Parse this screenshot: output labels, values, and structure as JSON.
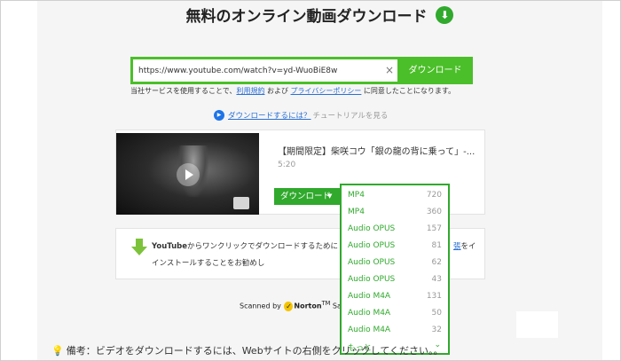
{
  "header": {
    "title": "無料のオンライン動画ダウンロード",
    "download_icon": "download-arrow-icon"
  },
  "search": {
    "url_value": "https://www.youtube.com/watch?v=yd-WuoBiE8w",
    "clear_icon": "×",
    "download_label": "ダウンロード"
  },
  "terms": {
    "prefix": "当社サービスを使用することで、",
    "terms_link": "利用規約",
    "and": " および ",
    "privacy_link": "プライバシーポリシー",
    "suffix": " に同意したことになります。"
  },
  "howto": {
    "link": "ダウンロードするには？",
    "tutorial": "チュートリアルを見る"
  },
  "result": {
    "title": "【期間限定】柴咲コウ「銀の龍の背に乗って」-...",
    "duration": "5:20",
    "download_label": "ダウンロード",
    "caret": "▼"
  },
  "dropdown": {
    "items": [
      {
        "format": "MP4",
        "quality": "720"
      },
      {
        "format": "MP4",
        "quality": "360"
      },
      {
        "format": "Audio OPUS",
        "quality": "157"
      },
      {
        "format": "Audio OPUS",
        "quality": "81"
      },
      {
        "format": "Audio OPUS",
        "quality": "62"
      },
      {
        "format": "Audio OPUS",
        "quality": "43"
      },
      {
        "format": "Audio M4A",
        "quality": "131"
      },
      {
        "format": "Audio M4A",
        "quality": "50"
      },
      {
        "format": "Audio M4A",
        "quality": "32"
      }
    ],
    "more_label": "もっと",
    "chevron": "⌄"
  },
  "promo": {
    "brand": "YouTube",
    "line1": "からワンクリックでダウンロードするために",
    "line2": "インストールすることをお勧めし",
    "tail_link": "張",
    "tail_text": "をイ"
  },
  "scanned": {
    "prefix": "Scanned by",
    "brand": "Norton",
    "tm": "TM",
    "suffix": " Safe"
  },
  "note": {
    "text": "備考：ビデオをダウンロードするには、Webサイトの右側をクリックしてください。。"
  },
  "colors": {
    "accent_green": "#4bbf29",
    "dark_green": "#30a92d",
    "link_blue": "#2a6fd6"
  }
}
